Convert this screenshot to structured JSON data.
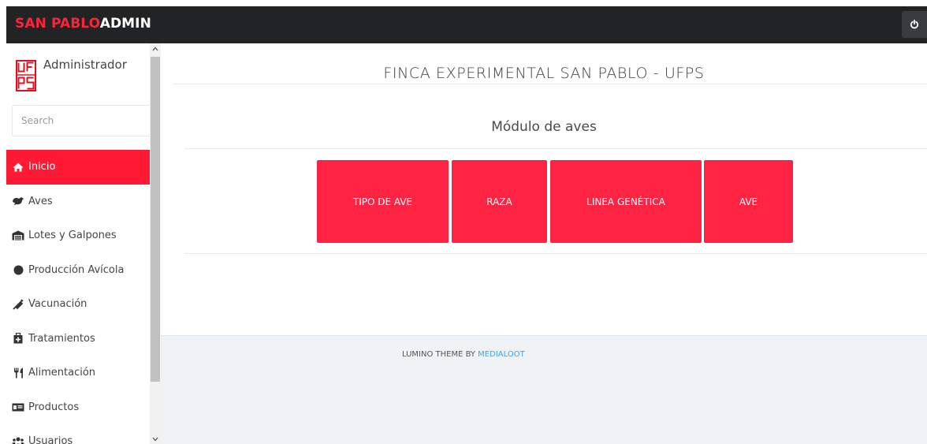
{
  "header": {
    "brand_primary": "SAN PABLO",
    "brand_secondary": "ADMIN",
    "power_icon": "power-icon"
  },
  "sidebar": {
    "user_name": "Administrador",
    "logo_text": "UFPS",
    "search_placeholder": "Search",
    "items": [
      {
        "label": "Inicio",
        "icon": "home-icon",
        "active": true
      },
      {
        "label": "Aves",
        "icon": "bird-icon"
      },
      {
        "label": "Lotes y Galpones",
        "icon": "warehouse-icon"
      },
      {
        "label": "Producción Avícola",
        "icon": "circle-icon"
      },
      {
        "label": "Vacunación",
        "icon": "syringe-icon"
      },
      {
        "label": "Tratamientos",
        "icon": "medkit-icon"
      },
      {
        "label": "Alimentación",
        "icon": "utensils-icon"
      },
      {
        "label": "Productos",
        "icon": "money-bill-icon"
      },
      {
        "label": "Usuarios",
        "icon": "users-icon"
      }
    ]
  },
  "main": {
    "page_title": "FINCA EXPERIMENTAL SAN PABLO - UFPS",
    "module_title": "Módulo de aves",
    "tiles": [
      {
        "label": "TIPO DE AVE"
      },
      {
        "label": "RAZA"
      },
      {
        "label": "LINEA GENÉTICA"
      },
      {
        "label": "AVE"
      }
    ]
  },
  "footer": {
    "text": "LUMINO THEME BY ",
    "link": "MEDIALOOT"
  },
  "colors": {
    "accent": "#fe1a35",
    "tile": "#fc2442",
    "topbar": "#222324",
    "link": "#30a5ff"
  }
}
